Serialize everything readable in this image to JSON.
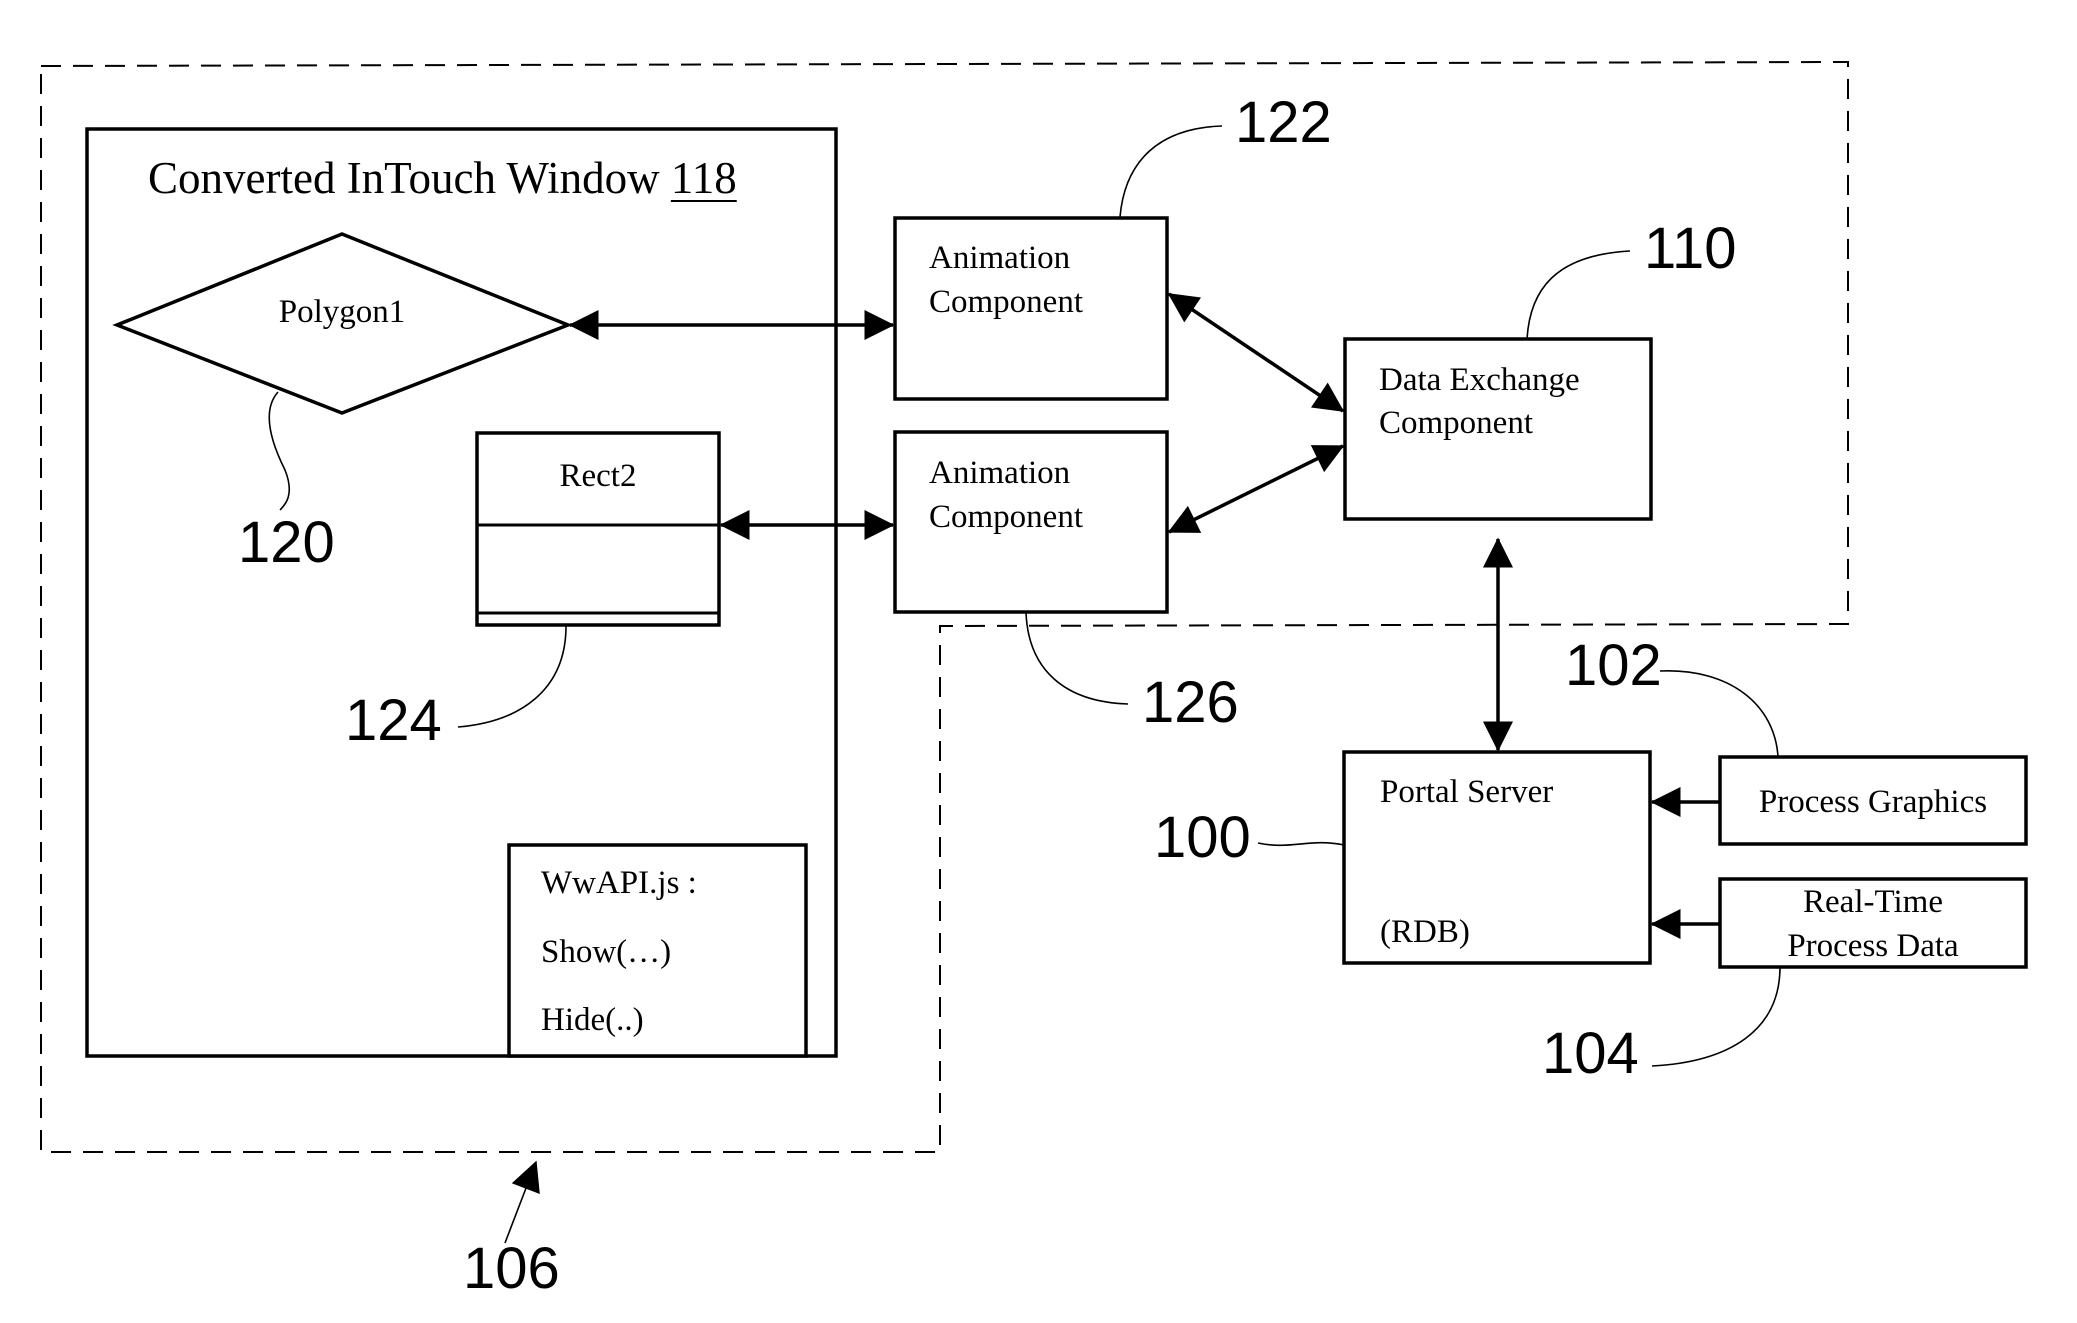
{
  "figure": {
    "boundary_ref": "106",
    "window": {
      "title": "Converted InTouch Window ",
      "title_ref": "118"
    },
    "polygon": {
      "label": "Polygon1",
      "ref": "120"
    },
    "rect": {
      "label": "Rect2",
      "ref": "124"
    },
    "script_box": {
      "lines": [
        "WwAPI.js :",
        "Show(…)",
        "Hide(..)"
      ]
    },
    "animation_components": [
      {
        "line1": "Animation",
        "line2": "Component",
        "ref": "122"
      },
      {
        "line1": "Animation",
        "line2": "Component",
        "ref": "126"
      }
    ],
    "data_exchange": {
      "line1": "Data Exchange",
      "line2": "Component",
      "ref": "110"
    },
    "portal_server": {
      "line1": "Portal Server",
      "line2": "(RDB)",
      "ref": "100"
    },
    "process_graphics": {
      "label": "Process Graphics",
      "ref": "102"
    },
    "real_time": {
      "line1": "Real-Time",
      "line2": "Process Data",
      "ref": "104"
    }
  }
}
